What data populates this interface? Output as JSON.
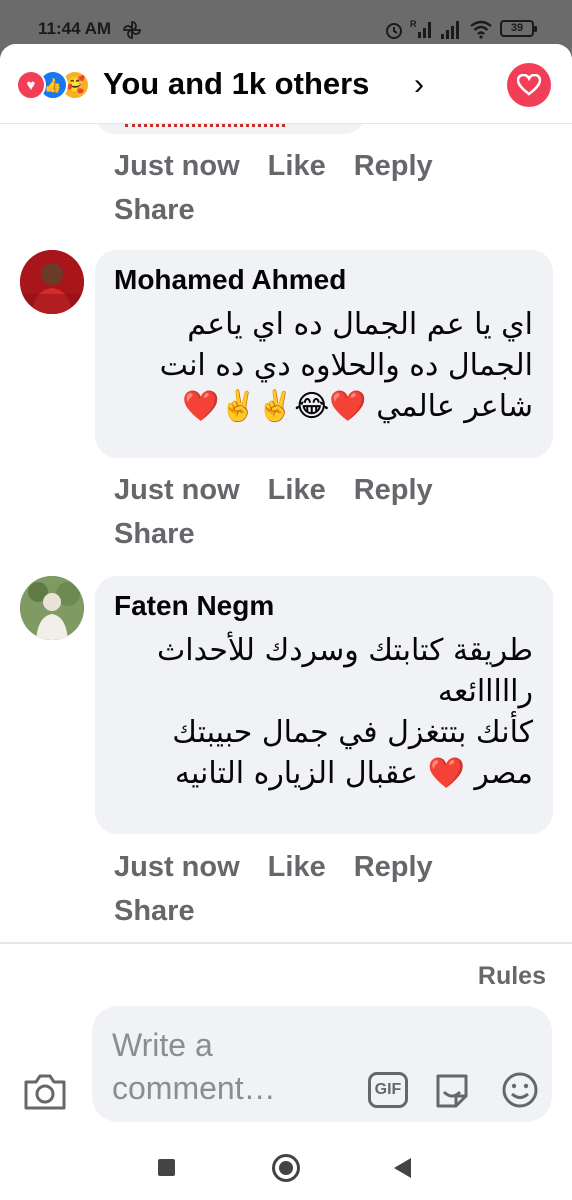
{
  "status_bar": {
    "time": "11:44 AM",
    "battery": "39",
    "icons": [
      "pinwheel-icon",
      "alarm-icon",
      "signal-r-icon",
      "signal-icon",
      "wifi-icon",
      "battery-icon"
    ]
  },
  "header": {
    "title": "You and 1k others",
    "reactions": [
      "love",
      "like",
      "care"
    ],
    "accent": "#f33e58"
  },
  "actions": {
    "time": "Just now",
    "like": "Like",
    "reply": "Reply",
    "share": "Share"
  },
  "comments": [
    {
      "author": "Mohamed Ahmed",
      "lines": [
        "اي يا عم الجمال ده اي ياعم",
        "الجمال ده والحلاوه دي ده انت",
        "شاعر عالمي ❤️😂✌️✌️❤️"
      ],
      "avatar_color": "#b3161c"
    },
    {
      "author": "Faten Negm",
      "lines": [
        "طريقة كتابتك وسردك للأحداث",
        "رااااائعه",
        "كأنك بتتغزل في جمال حبيبتك",
        "مصر ❤️ عقبال الزياره التانيه"
      ],
      "avatar_color": "#7a8f62"
    }
  ],
  "footer": {
    "rules": "Rules",
    "placeholder": "Write a comment…",
    "gif": "GIF"
  },
  "colors": {
    "bubble": "#f0f2f5",
    "secondary_text": "#65676b",
    "like_blue": "#1877f2"
  }
}
